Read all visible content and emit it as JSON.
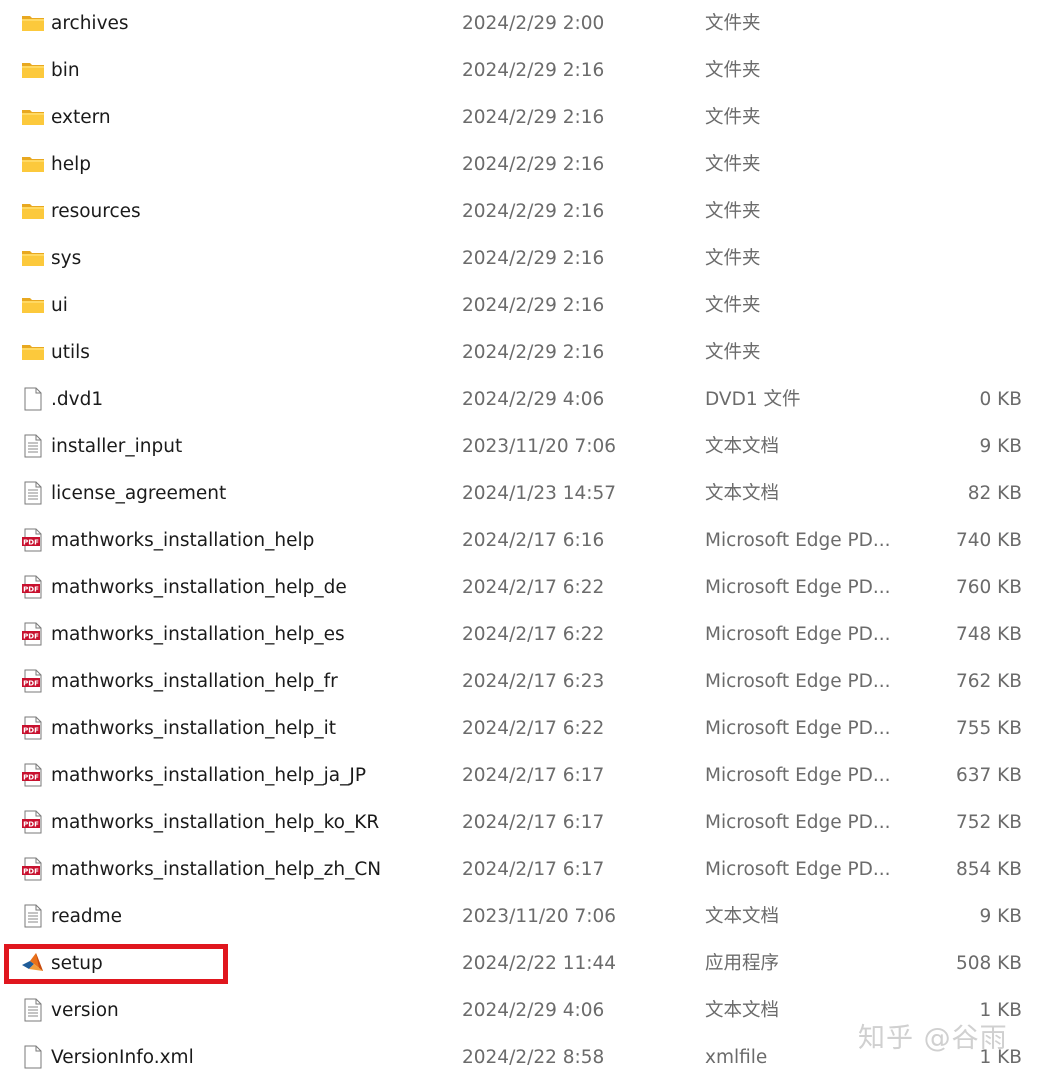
{
  "files": [
    {
      "name": "archives",
      "date": "2024/2/29 2:00",
      "type": "文件夹",
      "size": "",
      "icon": "folder-icon"
    },
    {
      "name": "bin",
      "date": "2024/2/29 2:16",
      "type": "文件夹",
      "size": "",
      "icon": "folder-icon"
    },
    {
      "name": "extern",
      "date": "2024/2/29 2:16",
      "type": "文件夹",
      "size": "",
      "icon": "folder-icon"
    },
    {
      "name": "help",
      "date": "2024/2/29 2:16",
      "type": "文件夹",
      "size": "",
      "icon": "folder-icon"
    },
    {
      "name": "resources",
      "date": "2024/2/29 2:16",
      "type": "文件夹",
      "size": "",
      "icon": "folder-icon"
    },
    {
      "name": "sys",
      "date": "2024/2/29 2:16",
      "type": "文件夹",
      "size": "",
      "icon": "folder-icon"
    },
    {
      "name": "ui",
      "date": "2024/2/29 2:16",
      "type": "文件夹",
      "size": "",
      "icon": "folder-icon"
    },
    {
      "name": "utils",
      "date": "2024/2/29 2:16",
      "type": "文件夹",
      "size": "",
      "icon": "folder-icon"
    },
    {
      "name": ".dvd1",
      "date": "2024/2/29 4:06",
      "type": "DVD1 文件",
      "size": "0 KB",
      "icon": "blank-file-icon"
    },
    {
      "name": "installer_input",
      "date": "2023/11/20 7:06",
      "type": "文本文档",
      "size": "9 KB",
      "icon": "text-file-icon"
    },
    {
      "name": "license_agreement",
      "date": "2024/1/23 14:57",
      "type": "文本文档",
      "size": "82 KB",
      "icon": "text-file-icon"
    },
    {
      "name": "mathworks_installation_help",
      "date": "2024/2/17 6:16",
      "type": "Microsoft Edge PD...",
      "size": "740 KB",
      "icon": "pdf-file-icon"
    },
    {
      "name": "mathworks_installation_help_de",
      "date": "2024/2/17 6:22",
      "type": "Microsoft Edge PD...",
      "size": "760 KB",
      "icon": "pdf-file-icon"
    },
    {
      "name": "mathworks_installation_help_es",
      "date": "2024/2/17 6:22",
      "type": "Microsoft Edge PD...",
      "size": "748 KB",
      "icon": "pdf-file-icon"
    },
    {
      "name": "mathworks_installation_help_fr",
      "date": "2024/2/17 6:23",
      "type": "Microsoft Edge PD...",
      "size": "762 KB",
      "icon": "pdf-file-icon"
    },
    {
      "name": "mathworks_installation_help_it",
      "date": "2024/2/17 6:22",
      "type": "Microsoft Edge PD...",
      "size": "755 KB",
      "icon": "pdf-file-icon"
    },
    {
      "name": "mathworks_installation_help_ja_JP",
      "date": "2024/2/17 6:17",
      "type": "Microsoft Edge PD...",
      "size": "637 KB",
      "icon": "pdf-file-icon"
    },
    {
      "name": "mathworks_installation_help_ko_KR",
      "date": "2024/2/17 6:17",
      "type": "Microsoft Edge PD...",
      "size": "752 KB",
      "icon": "pdf-file-icon"
    },
    {
      "name": "mathworks_installation_help_zh_CN",
      "date": "2024/2/17 6:17",
      "type": "Microsoft Edge PD...",
      "size": "854 KB",
      "icon": "pdf-file-icon"
    },
    {
      "name": "readme",
      "date": "2023/11/20 7:06",
      "type": "文本文档",
      "size": "9 KB",
      "icon": "text-file-icon"
    },
    {
      "name": "setup",
      "date": "2024/2/22 11:44",
      "type": "应用程序",
      "size": "508 KB",
      "icon": "matlab-app-icon"
    },
    {
      "name": "version",
      "date": "2024/2/29 4:06",
      "type": "文本文档",
      "size": "1 KB",
      "icon": "text-file-icon"
    },
    {
      "name": "VersionInfo.xml",
      "date": "2024/2/22 8:58",
      "type": "xmlfile",
      "size": "1 KB",
      "icon": "blank-file-icon"
    }
  ],
  "highlight": {
    "target": "setup",
    "color": "#e0161e"
  },
  "watermark": "知乎 @谷雨",
  "colors": {
    "name_text": "#1a1a1a",
    "meta_text": "#6b6b6b",
    "folder": "#f5c342",
    "pdf_red": "#c8102e"
  }
}
